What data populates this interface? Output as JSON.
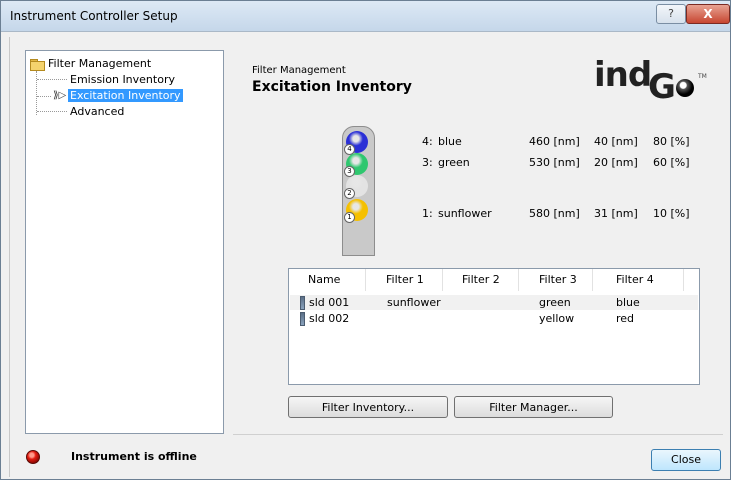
{
  "window": {
    "title": "Instrument Controller Setup",
    "help_button": "?",
    "close_button": "X"
  },
  "tree": {
    "root": "Filter Management",
    "items": [
      "Emission Inventory",
      "Excitation Inventory",
      "Advanced"
    ],
    "selected": "Excitation Inventory"
  },
  "panel": {
    "subtitle": "Filter Management",
    "title": "Excitation Inventory"
  },
  "logo": {
    "text_ind": "ind",
    "text_i": "i",
    "text_g": "G",
    "tm": "TM"
  },
  "wheel_slots": [
    {
      "number": "4",
      "color": "#2a2fd6"
    },
    {
      "number": "3",
      "color": "#2fc76f"
    },
    {
      "number": "2",
      "color": "#e3e3e3"
    },
    {
      "number": "1",
      "color": "#f5c000"
    }
  ],
  "filters": [
    {
      "slot": "4:",
      "name": "blue",
      "wavelength": "460 [nm]",
      "bandwidth": "40 [nm]",
      "transmission": "80 [%]"
    },
    {
      "slot": "3:",
      "name": "green",
      "wavelength": "530 [nm]",
      "bandwidth": "20 [nm]",
      "transmission": "60 [%]"
    },
    {
      "slot": "1:",
      "name": "sunflower",
      "wavelength": "580 [nm]",
      "bandwidth": "31 [nm]",
      "transmission": "10 [%]"
    }
  ],
  "table": {
    "columns": [
      "Name",
      "Filter 1",
      "Filter 2",
      "Filter 3",
      "Filter 4"
    ],
    "rows": [
      {
        "name": "sld 001",
        "filter1": "sunflower",
        "filter2": "",
        "filter3": "green",
        "filter4": "blue"
      },
      {
        "name": "sld 002",
        "filter1": "",
        "filter2": "",
        "filter3": "yellow",
        "filter4": "red"
      }
    ]
  },
  "buttons": {
    "filter_inventory": "Filter Inventory...",
    "filter_manager": "Filter Manager...",
    "close": "Close"
  },
  "status": {
    "text": "Instrument is offline",
    "led_color": "#e21b10"
  }
}
